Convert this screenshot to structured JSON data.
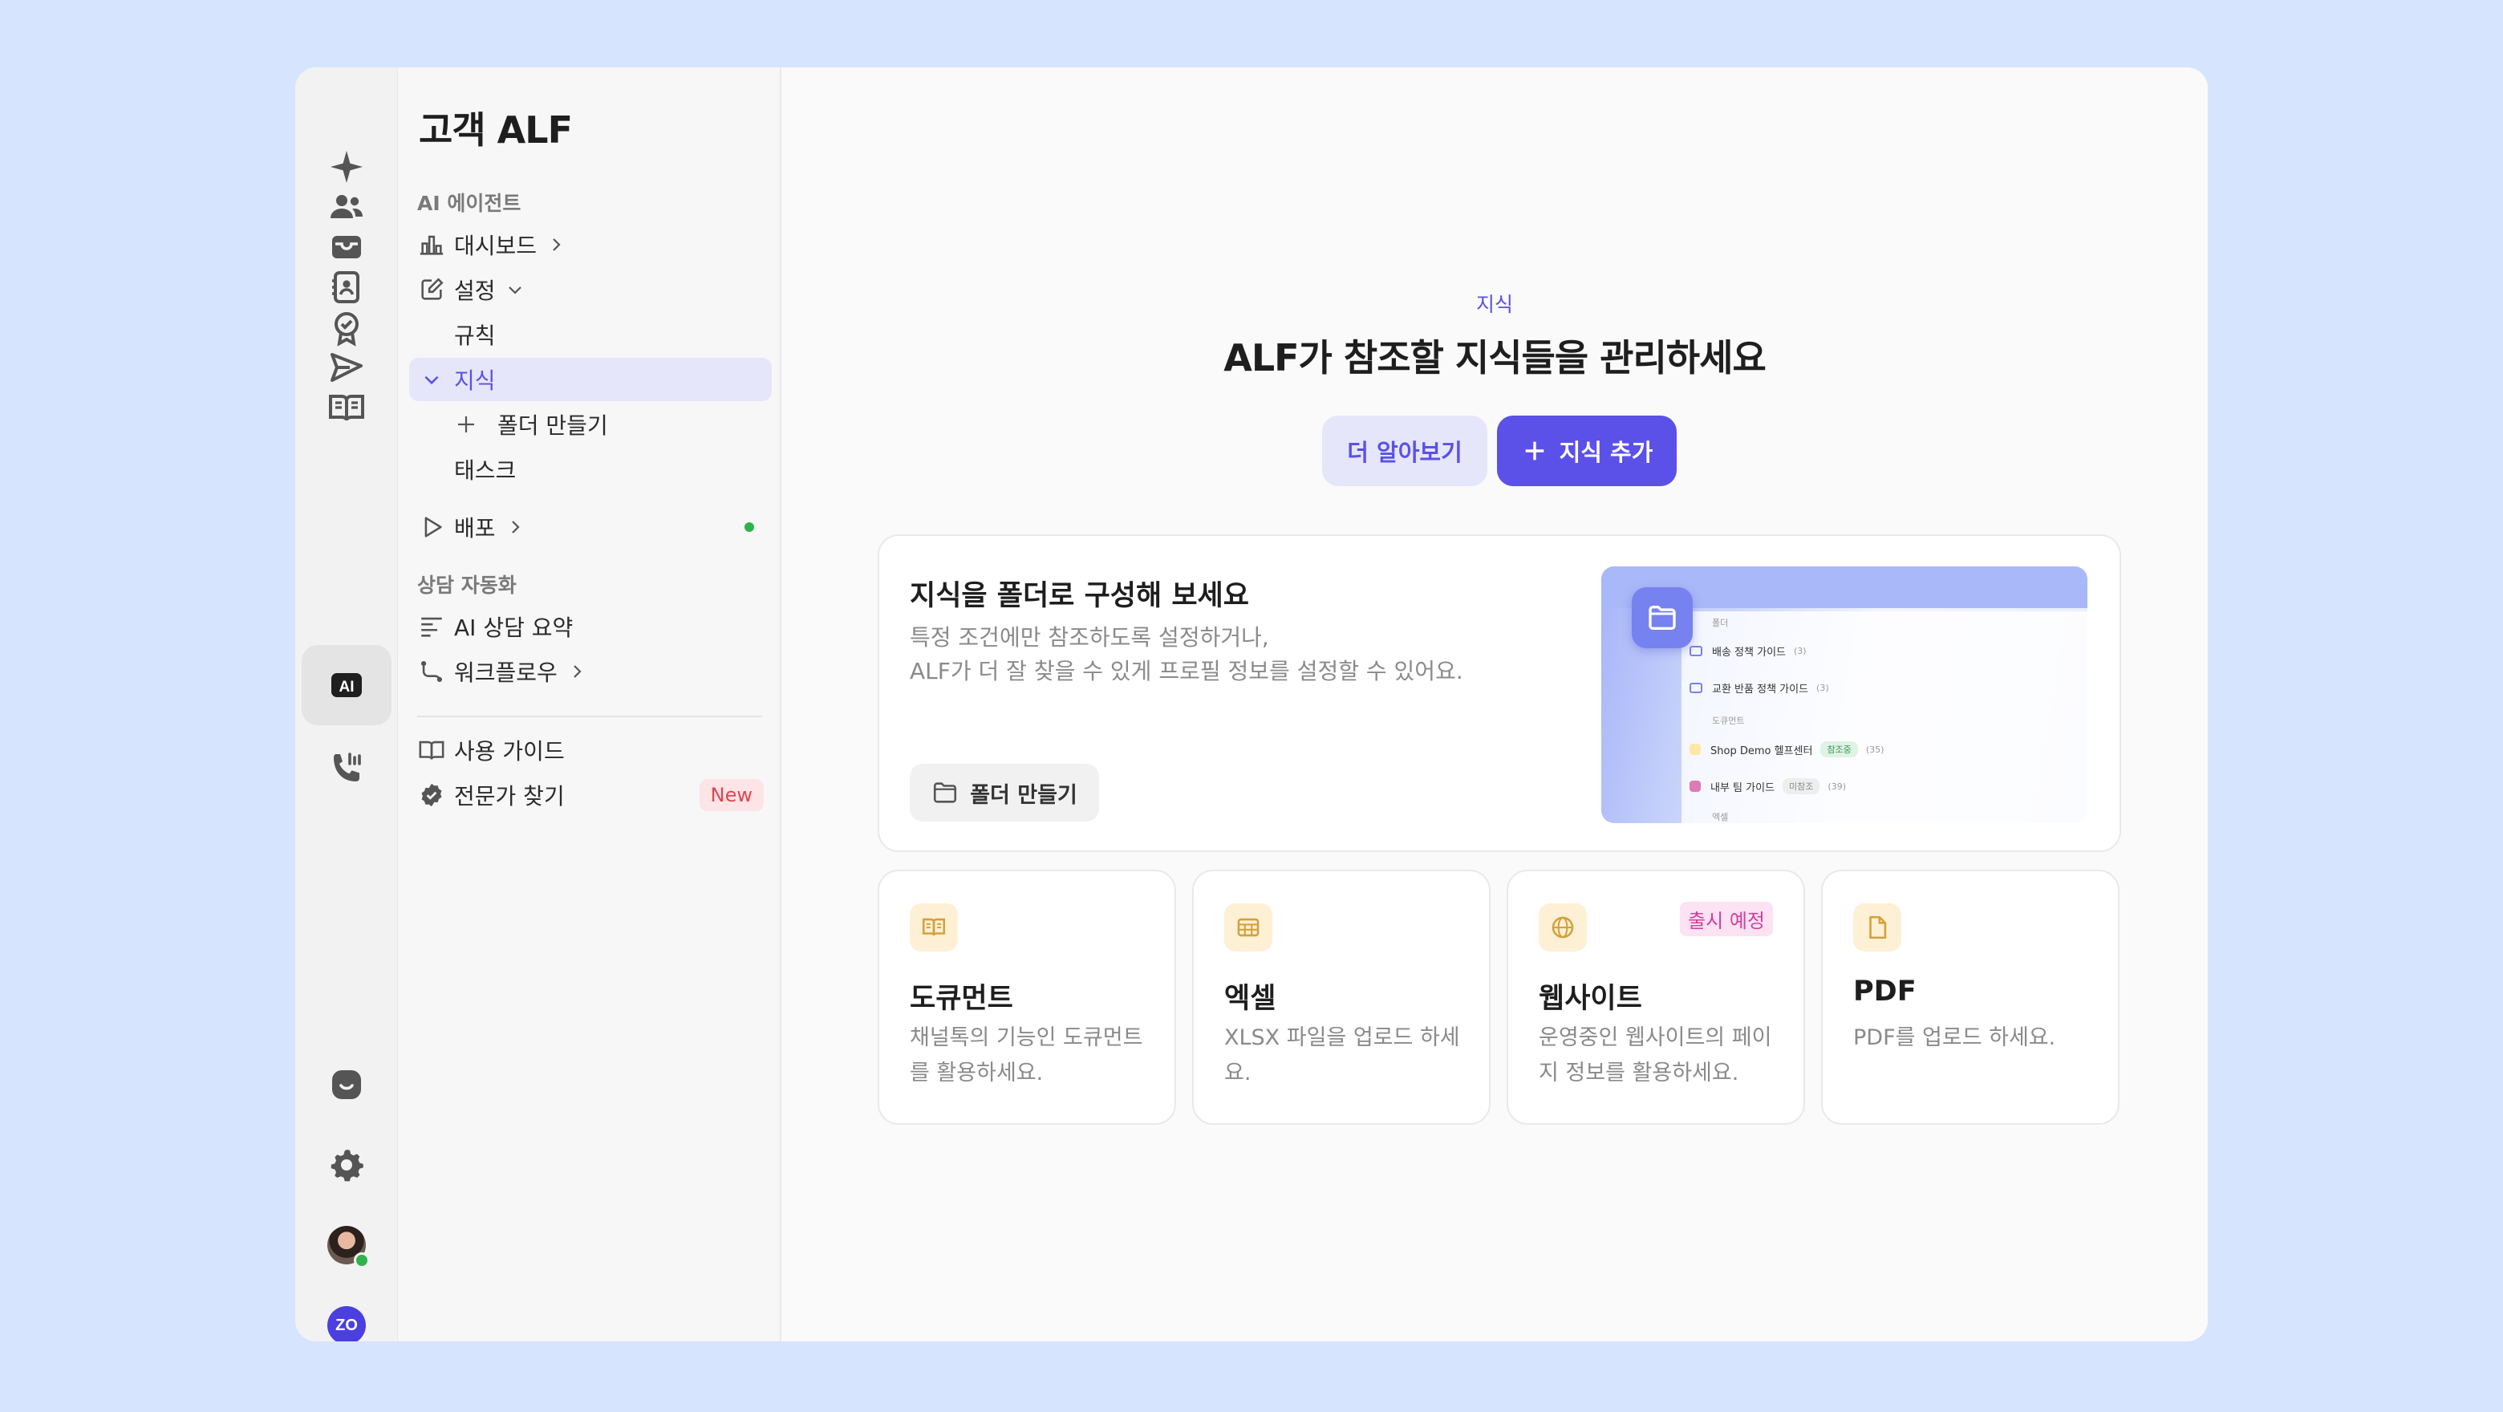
{
  "app": {
    "title": "고객 ALF"
  },
  "rail": {
    "items": [
      "sparkle-icon",
      "users-icon",
      "inbox-icon",
      "contacts-icon",
      "badge-icon",
      "send-icon",
      "book-icon",
      "ai-icon",
      "phone-icon",
      "chat-icon",
      "gear-icon",
      "avatar",
      "workspace-logo"
    ],
    "ai_label": "AI",
    "workspace_label": "ZO"
  },
  "nav": {
    "section_agent": "AI 에이전트",
    "dashboard": "대시보드",
    "settings": "설정",
    "rules": "규칙",
    "knowledge": "지식",
    "create_folder": "폴더 만들기",
    "tasks": "태스크",
    "deploy": "배포",
    "section_automation": "상담 자동화",
    "summary": "AI 상담 요약",
    "workflow": "워크플로우",
    "guide": "사용 가이드",
    "experts": "전문가 찾기",
    "new_badge": "New"
  },
  "main": {
    "eyebrow": "지식",
    "headline": "ALF가 참조할 지식들을 관리하세요",
    "learn_more": "더 알아보기",
    "add_knowledge": "지식 추가",
    "feature": {
      "title": "지식을 폴더로 구성해 보세요",
      "desc_line1": "특정 조건에만 참조하도록 설정하거나,",
      "desc_line2": "ALF가 더 잘 찾을 수 있게 프로필 정보를 설정할 수 있어요.",
      "button": "폴더 만들기",
      "preview": {
        "folder_header": "폴더",
        "folder1": "배송 정책 가이드",
        "folder1_count": "(3)",
        "folder2": "교환 반품 정책 가이드",
        "folder2_count": "(3)",
        "doc_header": "도큐먼트",
        "doc1": "Shop Demo 헬프센터",
        "doc1_tag": "참조중",
        "doc1_count": "(35)",
        "doc2": "내부 팀 가이드",
        "doc2_tag": "미참조",
        "doc2_count": "(39)",
        "excel_header": "엑셀"
      }
    },
    "cards": [
      {
        "icon": "book-icon",
        "title": "도큐먼트",
        "desc": "채널톡의 기능인 도큐먼트를 활용하세요."
      },
      {
        "icon": "table-icon",
        "title": "엑셀",
        "desc": "XLSX 파일을 업로드 하세요."
      },
      {
        "icon": "globe-icon",
        "title": "웹사이트",
        "desc": "운영중인 웹사이트의 페이지 정보를 활용하세요.",
        "badge": "출시 예정"
      },
      {
        "icon": "file-icon",
        "title": "PDF",
        "desc": "PDF를 업로드 하세요."
      }
    ]
  },
  "colors": {
    "accent": "#5b51e8",
    "background": "#d6e4fd",
    "card_icon_bg": "#fdf0d5",
    "icon_gold": "#d4a13a"
  }
}
